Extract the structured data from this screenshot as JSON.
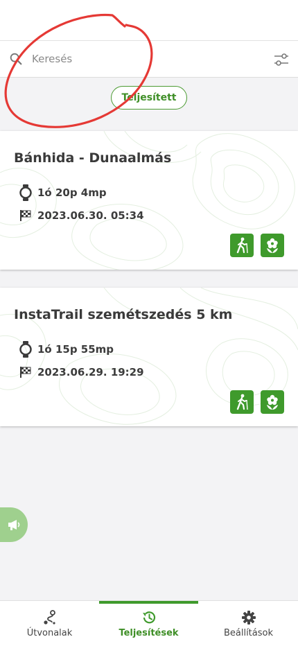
{
  "search": {
    "placeholder": "Keresés",
    "value": ""
  },
  "filter_chip": {
    "label": "Teljesített"
  },
  "routes": [
    {
      "title": "Bánhida - Dunaalmás",
      "duration": "1ó 20p 4mp",
      "finished_at": "2023.06.30. 05:34"
    },
    {
      "title": "InstaTrail szemétszedés 5 km",
      "duration": "1ó 15p 55mp",
      "finished_at": "2023.06.29. 19:29"
    }
  ],
  "nav": {
    "routes": "Útvonalak",
    "achievements": "Teljesítések",
    "settings": "Beállítások"
  },
  "colors": {
    "accent": "#3f9a2c",
    "annotation": "#e53935"
  }
}
